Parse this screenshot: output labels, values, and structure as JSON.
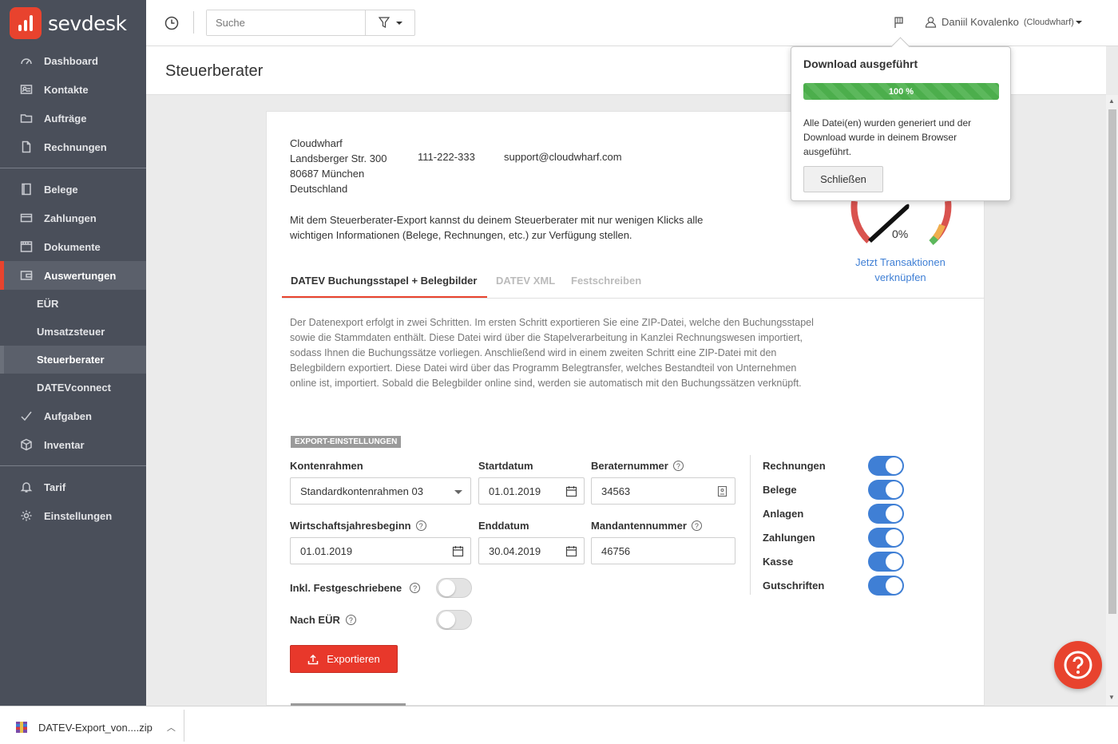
{
  "app": {
    "brand": "sevdesk",
    "accent": "#e8432e",
    "link": "#3f7fd5"
  },
  "sidebar": {
    "group1": [
      {
        "label": "Dashboard",
        "icon": "dashboard-icon"
      },
      {
        "label": "Kontakte",
        "icon": "contacts-icon"
      },
      {
        "label": "Aufträge",
        "icon": "folder-icon"
      },
      {
        "label": "Rechnungen",
        "icon": "document-icon"
      }
    ],
    "group2": [
      {
        "label": "Belege",
        "icon": "receipt-icon"
      },
      {
        "label": "Zahlungen",
        "icon": "card-icon"
      },
      {
        "label": "Dokumente",
        "icon": "archive-icon"
      },
      {
        "label": "Auswertungen",
        "icon": "report-icon",
        "active": true
      }
    ],
    "sub": [
      {
        "label": "EÜR"
      },
      {
        "label": "Umsatzsteuer"
      },
      {
        "label": "Steuerberater",
        "active": true
      },
      {
        "label": "DATEVconnect"
      }
    ],
    "group3": [
      {
        "label": "Aufgaben",
        "icon": "check-icon"
      },
      {
        "label": "Inventar",
        "icon": "box-icon"
      }
    ],
    "group4": [
      {
        "label": "Tarif",
        "icon": "bell-icon"
      },
      {
        "label": "Einstellungen",
        "icon": "gear-icon"
      }
    ]
  },
  "topbar": {
    "search_placeholder": "Suche",
    "user_name": "Daniil Kovalenko",
    "user_company": "(Cloudwharf)"
  },
  "page": {
    "title": "Steuerberater"
  },
  "company": {
    "name": "Cloudwharf",
    "street": "Landsberger Str. 300",
    "city": "80687 München",
    "country": "Deutschland",
    "phone": "111-222-333",
    "email": "support@cloudwharf.com"
  },
  "intro": "Mit dem Steuerberater-Export kannst du deinem Steuerberater mit nur wenigen Klicks alle wichtigen Informationen (Belege, Rechnungen, etc.) zur Verfügung stellen.",
  "tabs": [
    {
      "label": "DATEV Buchungsstapel + Belegbilder",
      "active": true
    },
    {
      "label": "DATEV XML"
    },
    {
      "label": "Festschreiben"
    }
  ],
  "description": "Der Datenexport erfolgt in zwei Schritten. Im ersten Schritt exportieren Sie eine ZIP-Datei, welche den Buchungsstapel sowie die Stammdaten enthält. Diese Datei wird über die Stapelverarbeitung in Kanzlei Rechnungswesen importiert, sodass Ihnen die Buchungssätze vorliegen. Anschließend wird in einem zweiten Schritt eine ZIP-Datei mit den Belegbildern exportiert. Diese Datei wird über das Programm Belegtransfer, welches Bestandteil von Unternehmen online ist, importiert. Sobald die Belegbilder online sind, werden sie automatisch mit den Buchungssätzen verknüpft.",
  "export": {
    "section_label": "EXPORT-EINSTELLUNGEN",
    "kontenrahmen_label": "Kontenrahmen",
    "kontenrahmen_value": "Standardkontenrahmen 03",
    "startdatum_label": "Startdatum",
    "startdatum_value": "01.01.2019",
    "beraternummer_label": "Beraternummer",
    "beraternummer_value": "34563",
    "wjb_label": "Wirtschaftsjahresbeginn",
    "wjb_value": "01.01.2019",
    "enddatum_label": "Enddatum",
    "enddatum_value": "30.04.2019",
    "mandant_label": "Mandantennummer",
    "mandant_value": "46756",
    "festgeschrieben_label": "Inkl. Festgeschriebene",
    "festgeschrieben_on": false,
    "nach_eur_label": "Nach EÜR",
    "nach_eur_on": false,
    "button_label": "Exportieren",
    "toggles": [
      {
        "label": "Rechnungen",
        "on": true
      },
      {
        "label": "Belege",
        "on": true
      },
      {
        "label": "Anlagen",
        "on": true
      },
      {
        "label": "Zahlungen",
        "on": true
      },
      {
        "label": "Kasse",
        "on": true
      },
      {
        "label": "Gutschriften",
        "on": true
      }
    ]
  },
  "gauge": {
    "value": "0%",
    "link_label": "Jetzt Transaktionen verknüpfen"
  },
  "popover": {
    "title": "Download ausgeführt",
    "progress": 1.0,
    "progress_label": "100 %",
    "text": "Alle Datei(en) wurden generiert und der Download wurde in deinem Browser ausgeführt.",
    "close_label": "Schließen"
  },
  "download_bar": {
    "filename": "DATEV-Export_von....zip"
  }
}
